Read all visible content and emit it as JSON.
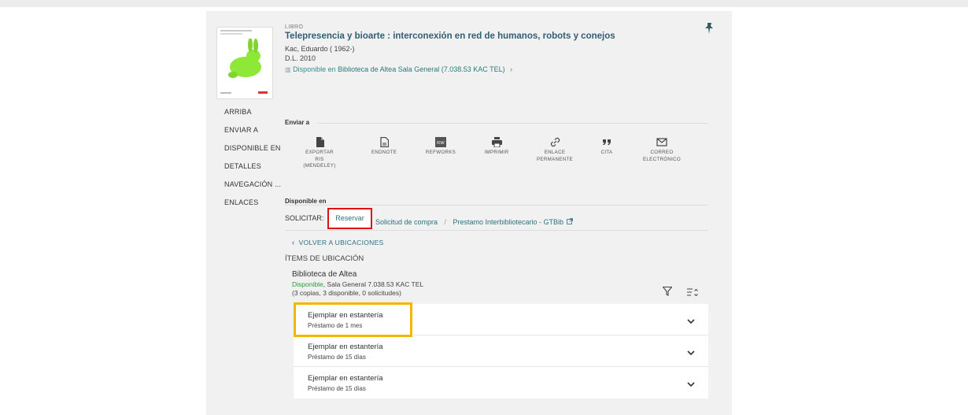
{
  "record": {
    "type": "LIBRO",
    "title": "Telepresencia y bioarte : interconexión en red de humanos, robots y conejos",
    "author": "Kac, Eduardo ( 1962-)",
    "date": "D.L. 2010",
    "availability_prefix": "Disponible en",
    "availability_library": "Biblioteca de Altea",
    "availability_location": "Sala General (7.038.53 KAC TEL)",
    "availability_chevron": "›"
  },
  "nav": {
    "items": [
      {
        "label": "ARRIBA"
      },
      {
        "label": "ENVIAR A"
      },
      {
        "label": "DISPONIBLE EN"
      },
      {
        "label": "DETALLES"
      },
      {
        "label": "NAVEGACIÓN ..."
      },
      {
        "label": "ENLACES"
      }
    ]
  },
  "send_to": {
    "title": "Enviar a",
    "actions": [
      {
        "label": "EXPORTAR RIS (MENDELEY)",
        "icon": "file-icon"
      },
      {
        "label": "ENDNOTE",
        "icon": "document-icon"
      },
      {
        "label": "REFWORKS",
        "icon": "refworks-icon"
      },
      {
        "label": "IMPRIMIR",
        "icon": "printer-icon"
      },
      {
        "label": "ENLACE PERMANENTE",
        "icon": "link-icon"
      },
      {
        "label": "CITA",
        "icon": "quote-icon"
      },
      {
        "label": "CORREO ELECTRÓNICO",
        "icon": "mail-icon"
      }
    ],
    "refworks_badge": "RW"
  },
  "available": {
    "title": "Disponible en",
    "request_label": "SOLICITAR:",
    "reserve_label": "Reservar",
    "purchase_label": "Solicitud de compra",
    "separator": "/",
    "interlibrary_label": "Prestamo Interbibliotecario - GTBib",
    "back_label": "VOLVER A UBICACIONES",
    "items_heading": "ÍTEMS DE UBICACIÓN",
    "library": "Biblioteca de Altea",
    "status": "Disponible",
    "location_detail": ", Sala General 7.038.53 KAC TEL",
    "copies": "(3 copias, 3 disponible, 0 solicitudes)"
  },
  "items": [
    {
      "title": "Ejemplar en estantería",
      "loan": "Préstamo de 1 mes"
    },
    {
      "title": "Ejemplar en estantería",
      "loan": "Préstamo de 15 días"
    },
    {
      "title": "Ejemplar en estantería",
      "loan": "Préstamo de 15 días"
    }
  ],
  "colors": {
    "reserve_highlight": "#e01010",
    "item_highlight": "#f2b600",
    "link": "#2f6f7f",
    "status_green": "#2e9a3a"
  }
}
